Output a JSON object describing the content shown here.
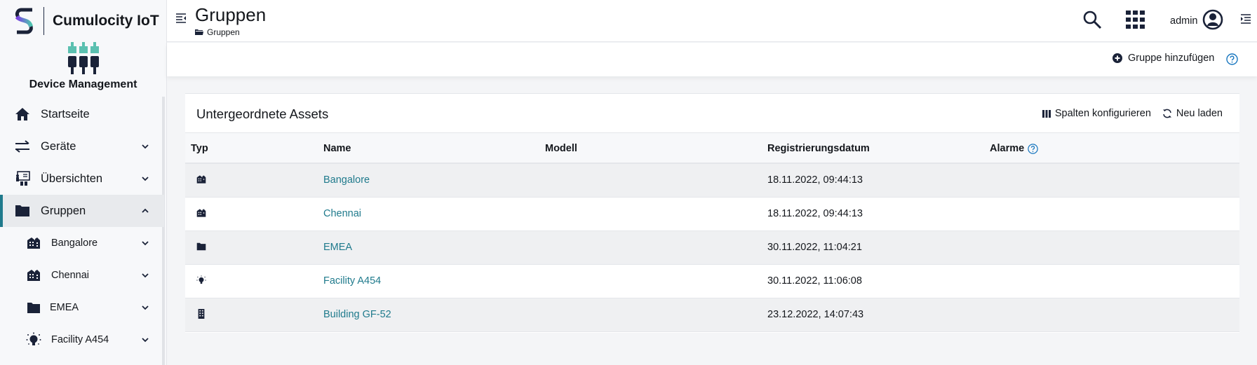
{
  "brand": {
    "name": "Cumulocity IoT",
    "logo_icon": "cumulocity-logo-icon"
  },
  "app": {
    "name": "Device Management",
    "icon": "device-management-icon"
  },
  "sidebar": {
    "items": [
      {
        "label": "Startseite",
        "icon": "home-icon",
        "expandable": false,
        "active": false
      },
      {
        "label": "Geräte",
        "icon": "exchange-arrows-icon",
        "expandable": true,
        "active": false
      },
      {
        "label": "Übersichten",
        "icon": "presentation-icon",
        "expandable": true,
        "active": false
      },
      {
        "label": "Gruppen",
        "icon": "folder-icon",
        "expandable": true,
        "expanded": true,
        "active": true
      }
    ],
    "subitems": [
      {
        "label": "Bangalore",
        "icon": "building-icon"
      },
      {
        "label": "Chennai",
        "icon": "building-icon"
      },
      {
        "label": "EMEA",
        "icon": "folder-icon"
      },
      {
        "label": "Facility A454",
        "icon": "lightbulb-icon"
      }
    ]
  },
  "header": {
    "title": "Gruppen",
    "breadcrumb": "Gruppen",
    "user": "admin"
  },
  "actionbar": {
    "add_group": "Gruppe hinzufügen"
  },
  "card": {
    "title": "Untergeordnete Assets",
    "configure_columns": "Spalten konfigurieren",
    "reload": "Neu laden",
    "columns": [
      "Typ",
      "Name",
      "Modell",
      "Registrierungsdatum",
      "Alarme"
    ],
    "rows": [
      {
        "type_icon": "building-icon",
        "name": "Bangalore",
        "model": "",
        "date": "18.11.2022, 09:44:13",
        "alarms": ""
      },
      {
        "type_icon": "building-icon",
        "name": "Chennai",
        "model": "",
        "date": "18.11.2022, 09:44:13",
        "alarms": ""
      },
      {
        "type_icon": "folder-icon",
        "name": "EMEA",
        "model": "",
        "date": "30.11.2022, 11:04:21",
        "alarms": ""
      },
      {
        "type_icon": "lightbulb-icon",
        "name": "Facility A454",
        "model": "",
        "date": "30.11.2022, 11:06:08",
        "alarms": ""
      },
      {
        "type_icon": "office-building-icon",
        "name": "Building GF-52",
        "model": "",
        "date": "23.12.2022, 14:07:43",
        "alarms": ""
      }
    ]
  },
  "colors": {
    "accent": "#1f7a8c",
    "text": "#14171c",
    "help": "#1776bf",
    "teal": "#5bc0b0"
  }
}
